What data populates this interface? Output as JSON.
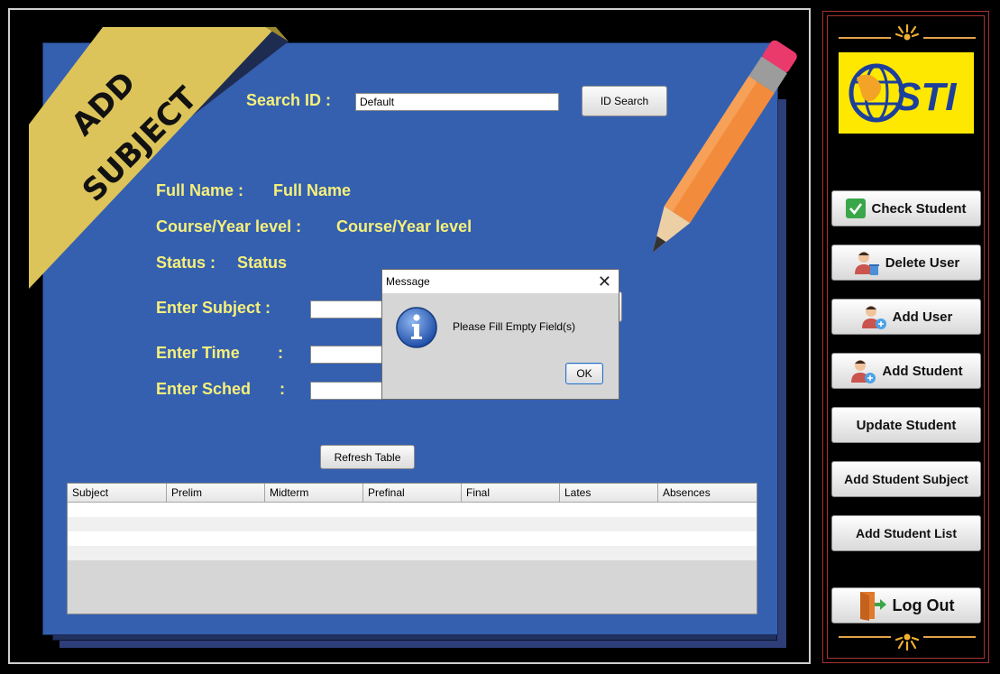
{
  "colors": {
    "panel": "#3560b0",
    "label_yellow": "#f6f07a",
    "ribbon": "#dcc45a",
    "sidebar_border": "#a83232"
  },
  "ribbon": {
    "text": "ADD SUBJECT"
  },
  "search": {
    "label": "Search ID :",
    "value": "Default",
    "button": "ID Search"
  },
  "info": {
    "full_name_label": "Full Name :",
    "full_name_value": "Full Name",
    "course_label": "Course/Year level :",
    "course_value": "Course/Year level",
    "status_label": "Status :",
    "status_value": "Status"
  },
  "form": {
    "subject_label": "Enter Subject :",
    "time_label": "Enter Time",
    "time_colon": ":",
    "sched_label": "Enter Sched",
    "sched_colon": ":"
  },
  "refresh_button": "Refresh Table",
  "table": {
    "columns": [
      "Subject",
      "Prelim",
      "Midterm",
      "Prefinal",
      "Final",
      "Lates",
      "Absences"
    ],
    "rows": []
  },
  "dialog": {
    "title": "Message",
    "message": "Please Fill Empty Field(s)",
    "ok": "OK",
    "icon": "info-icon"
  },
  "sidebar": {
    "logo_text": "STI",
    "buttons": [
      {
        "label": "Check Student",
        "icon": "check-icon"
      },
      {
        "label": "Delete User",
        "icon": "delete-user-icon"
      },
      {
        "label": "Add User",
        "icon": "add-user-icon"
      },
      {
        "label": "Add Student",
        "icon": "add-student-icon"
      },
      {
        "label": "Update Student",
        "icon": ""
      },
      {
        "label": "Add Student Subject",
        "icon": ""
      },
      {
        "label": "Add Student List",
        "icon": ""
      },
      {
        "label": "Log Out",
        "icon": "logout-icon"
      }
    ]
  }
}
